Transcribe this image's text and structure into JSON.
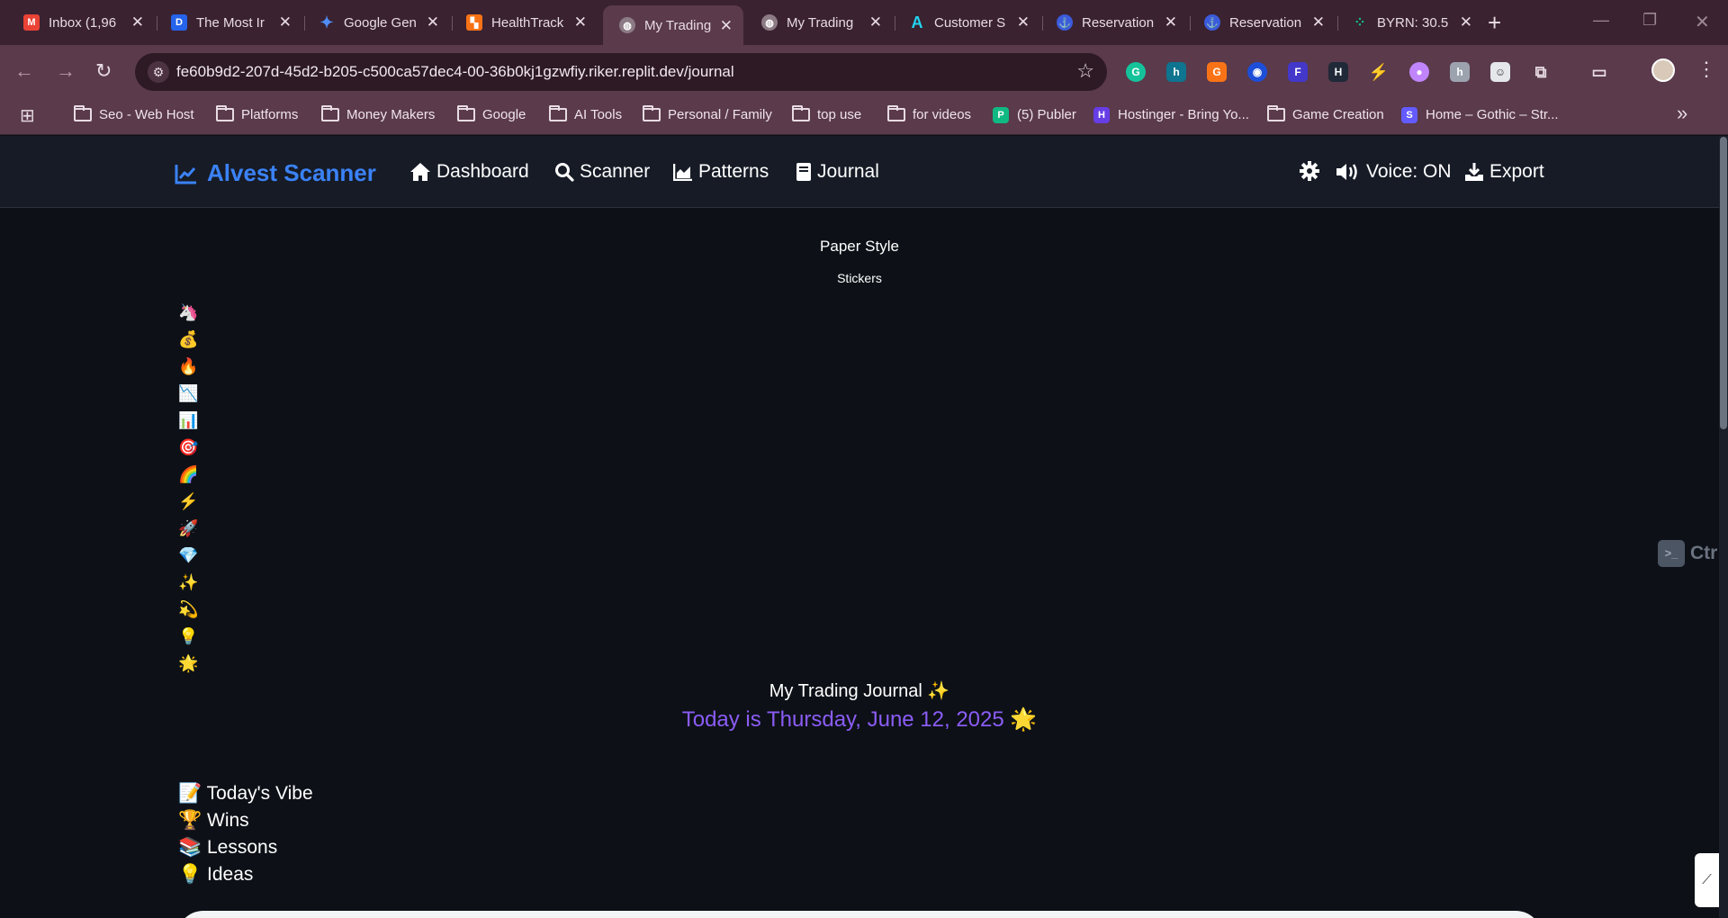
{
  "browser": {
    "tabs": [
      {
        "title": "Inbox (1,96",
        "favicon": "gmail-icon",
        "color": "#ea4335"
      },
      {
        "title": "The Most Ir",
        "favicon": "d-icon",
        "color": "#2563eb"
      },
      {
        "title": "Google Gen",
        "favicon": "gemini-icon",
        "color": "#4f8ef7"
      },
      {
        "title": "HealthTrack",
        "favicon": "healthtrack-icon",
        "color": "#f97316"
      },
      {
        "title": "My Trading",
        "favicon": "globe-icon",
        "color": "#b0a0a8"
      },
      {
        "title": "My Trading",
        "favicon": "globe-icon",
        "color": "#b0a0a8"
      },
      {
        "title": "Customer S",
        "favicon": "a-icon",
        "color": "#22d3ee"
      },
      {
        "title": "Reservation",
        "favicon": "anchor-icon",
        "color": "#3b5bdb"
      },
      {
        "title": "Reservation",
        "favicon": "anchor-icon",
        "color": "#3b5bdb"
      },
      {
        "title": "BYRN: 30.5",
        "favicon": "byrn-icon",
        "color": "#10b981"
      }
    ],
    "url": "fe60b9d2-207d-45d2-b205-c500ca57dec4-00-36b0kj1gzwfiy.riker.replit.dev/journal",
    "bookmarks": [
      {
        "label": "Seo - Web Host",
        "type": "folder"
      },
      {
        "label": "Platforms",
        "type": "folder"
      },
      {
        "label": "Money Makers",
        "type": "folder"
      },
      {
        "label": "Google",
        "type": "folder"
      },
      {
        "label": "AI Tools",
        "type": "folder"
      },
      {
        "label": "Personal / Family",
        "type": "folder"
      },
      {
        "label": "top use",
        "type": "folder"
      },
      {
        "label": "for videos",
        "type": "folder"
      },
      {
        "label": "(5) Publer",
        "type": "site",
        "color": "#10b981",
        "glyph": "P"
      },
      {
        "label": "Hostinger - Bring Yo...",
        "type": "site",
        "color": "#673de6",
        "glyph": "H"
      },
      {
        "label": "Game Creation",
        "type": "folder"
      },
      {
        "label": "Home – Gothic – Str...",
        "type": "site",
        "color": "#635bff",
        "glyph": "S"
      }
    ]
  },
  "app": {
    "brand": "Alvest Scanner",
    "nav": {
      "dashboard": "Dashboard",
      "scanner": "Scanner",
      "patterns": "Patterns",
      "journal": "Journal",
      "voice": "Voice: ON",
      "export": "Export"
    },
    "paper_style": "Paper Style",
    "stickers_label": "Stickers",
    "stickers": [
      "🦄",
      "💰",
      "🔥",
      "📉",
      "📊",
      "🎯",
      "🌈",
      "⚡",
      "🚀",
      "💎",
      "✨",
      "💫",
      "💡",
      "🌟"
    ],
    "ghost_hint": "Ctr",
    "journal_title": "My Trading Journal ✨",
    "date_line": "Today is Thursday, June 12, 2025 🌟",
    "sections": [
      {
        "icon": "📝",
        "label": "Today's Vibe"
      },
      {
        "icon": "🏆",
        "label": "Wins"
      },
      {
        "icon": "📚",
        "label": "Lessons"
      },
      {
        "icon": "💡",
        "label": "Ideas"
      }
    ]
  },
  "colors": {
    "brand_blue": "#3b82f6",
    "date_purple": "#8b5cf6",
    "page_bg": "#0d1117",
    "chrome_bg": "#5a3a4b"
  }
}
